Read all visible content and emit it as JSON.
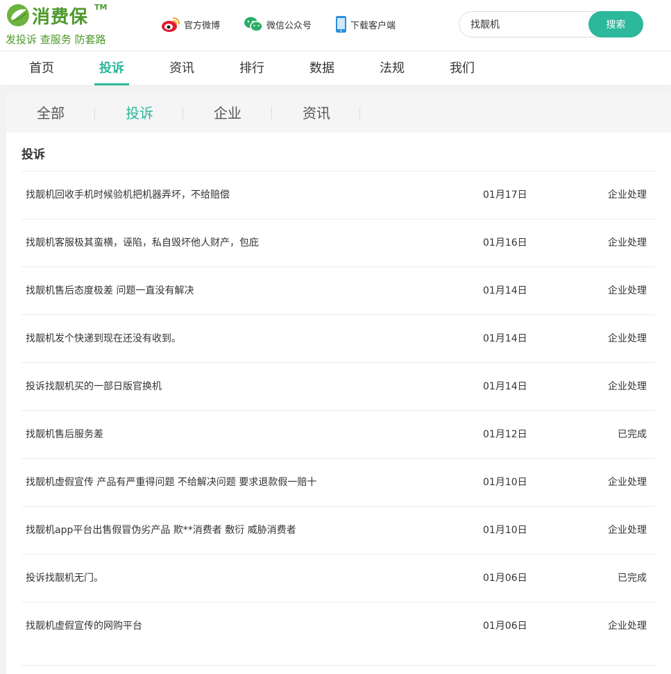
{
  "brand": {
    "name": "消费保",
    "tm": "TM",
    "slogan": "发投诉 查服务 防套路",
    "color": "#4c9a2a",
    "accent": "#2bb89b"
  },
  "header": {
    "links": [
      {
        "label": "官方微博",
        "icon": "weibo-icon"
      },
      {
        "label": "微信公众号",
        "icon": "wechat-icon"
      },
      {
        "label": "下载客户端",
        "icon": "phone-icon"
      }
    ],
    "search": {
      "value": "找靓机",
      "button_label": "搜索"
    }
  },
  "nav": {
    "items": [
      "首页",
      "投诉",
      "资讯",
      "排行",
      "数据",
      "法规",
      "我们"
    ],
    "active": "投诉"
  },
  "sub_tabs": {
    "items": [
      "全部",
      "投诉",
      "企业",
      "资讯"
    ],
    "active": "投诉"
  },
  "section": {
    "title": "投诉"
  },
  "complaints": [
    {
      "title": "找靓机回收手机时候验机把机器弄坏，不给赔偿",
      "date": "01月17日",
      "status": "企业处理"
    },
    {
      "title": "找靓机客服极其蛮横，诬陷，私自毁坏他人财产，包庇",
      "date": "01月16日",
      "status": "企业处理"
    },
    {
      "title": "找靓机售后态度极差 问题一直没有解决",
      "date": "01月14日",
      "status": "企业处理"
    },
    {
      "title": "找靓机发个快递到现在还没有收到。",
      "date": "01月14日",
      "status": "企业处理"
    },
    {
      "title": "投诉找靓机买的一部日版官换机",
      "date": "01月14日",
      "status": "企业处理"
    },
    {
      "title": "找靓机售后服务差",
      "date": "01月12日",
      "status": "已完成"
    },
    {
      "title": "找靓机虚假宣传 产品有严重得问题 不给解决问题 要求退款假一赔十",
      "date": "01月10日",
      "status": "企业处理"
    },
    {
      "title": "找靓机app平台出售假冒伪劣产品 欺**消费者 敷衍 威胁消费者",
      "date": "01月10日",
      "status": "企业处理"
    },
    {
      "title": "投诉找靓机无门。",
      "date": "01月06日",
      "status": "已完成"
    },
    {
      "title": "找靓机虚假宣传的网购平台",
      "date": "01月06日",
      "status": "企业处理"
    }
  ]
}
